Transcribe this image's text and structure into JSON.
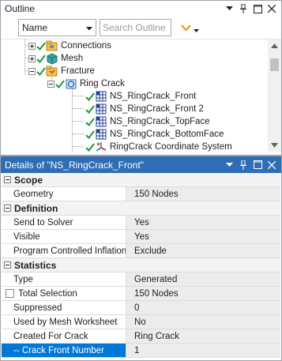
{
  "outline": {
    "title": "Outline",
    "toolbar": {
      "filter_combo_value": "Name",
      "search_placeholder": "Search Outline"
    },
    "tree": [
      {
        "label": "Connections",
        "icon": "connections-folder-icon",
        "expanded": false
      },
      {
        "label": "Mesh",
        "icon": "mesh-icon",
        "expanded": false
      },
      {
        "label": "Fracture",
        "icon": "fracture-folder-icon",
        "expanded": true
      },
      {
        "label": "Ring Crack",
        "icon": "crack-icon",
        "expanded": true
      },
      {
        "label": "NS_RingCrack_Front",
        "icon": "named-selection-icon"
      },
      {
        "label": "NS_RingCrack_Front 2",
        "icon": "named-selection-icon"
      },
      {
        "label": "NS_RingCrack_TopFace",
        "icon": "named-selection-icon"
      },
      {
        "label": "NS_RingCrack_BottomFace",
        "icon": "named-selection-icon"
      },
      {
        "label": "RingCrack Coordinate System",
        "icon": "coordinate-system-icon"
      }
    ]
  },
  "details": {
    "title": "Details of \"NS_RingCrack_Front\"",
    "sections": {
      "scope": {
        "title": "Scope",
        "rows": [
          {
            "key": "Geometry",
            "value": "150 Nodes"
          }
        ]
      },
      "definition": {
        "title": "Definition",
        "rows": [
          {
            "key": "Send to Solver",
            "value": "Yes"
          },
          {
            "key": "Visible",
            "value": "Yes"
          },
          {
            "key": "Program Controlled Inflation",
            "value": "Exclude"
          }
        ]
      },
      "statistics": {
        "title": "Statistics",
        "rows": [
          {
            "key": "Type",
            "value": "Generated"
          },
          {
            "key": "Total Selection",
            "value": "150 Nodes"
          },
          {
            "key": "Suppressed",
            "value": "0"
          },
          {
            "key": "Used by Mesh Worksheet",
            "value": "No"
          },
          {
            "key": "Created For Crack",
            "value": "Ring Crack"
          },
          {
            "key": "-- Crack Front Number",
            "value": "1"
          }
        ]
      }
    }
  },
  "colors": {
    "accent": "#2f6db5",
    "selection": "#0078d7",
    "check_green": "#1e9a3c",
    "filter_orange": "#e89a2e"
  }
}
